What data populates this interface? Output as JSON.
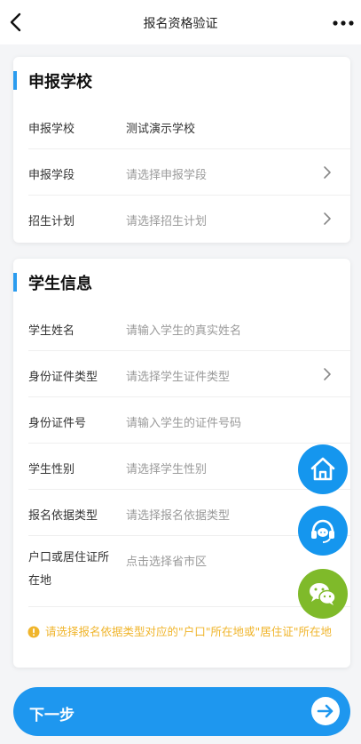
{
  "header": {
    "title": "报名资格验证",
    "back_icon": "chevron-left-icon",
    "more_icon": "more-dots-icon"
  },
  "school_section": {
    "title": "申报学校",
    "rows": [
      {
        "label": "申报学校",
        "value": "测试演示学校"
      },
      {
        "label": "申报学段",
        "placeholder": "请选择申报学段"
      },
      {
        "label": "招生计划",
        "placeholder": "请选择招生计划"
      }
    ]
  },
  "student_section": {
    "title": "学生信息",
    "rows": [
      {
        "label": "学生姓名",
        "placeholder": "请输入学生的真实姓名"
      },
      {
        "label": "身份证件类型",
        "placeholder": "请选择学生证件类型"
      },
      {
        "label": "身份证件号",
        "placeholder": "请输入学生的证件号码"
      },
      {
        "label": "学生性别",
        "placeholder": "请选择学生性别"
      },
      {
        "label": "报名依据类型",
        "placeholder": "请选择报名依据类型"
      },
      {
        "label": "户口或居住证所在地",
        "placeholder": "点击选择省市区"
      }
    ],
    "hint": "请选择报名依据类型对应的\"户口\"所在地或\"居住证\"所在地"
  },
  "floating_buttons": [
    {
      "name": "home",
      "icon": "home-icon"
    },
    {
      "name": "service",
      "icon": "customer-service-icon"
    },
    {
      "name": "wechat",
      "icon": "wechat-icon"
    }
  ],
  "footer": {
    "next_label": "下一步",
    "next_icon": "arrow-right-circle-icon"
  },
  "colors": {
    "primary": "#1e97ef",
    "accent_bar": "#2a9cef",
    "hint": "#f0b52c",
    "wechat": "#7fba2a",
    "placeholder": "#9a9a9a"
  }
}
